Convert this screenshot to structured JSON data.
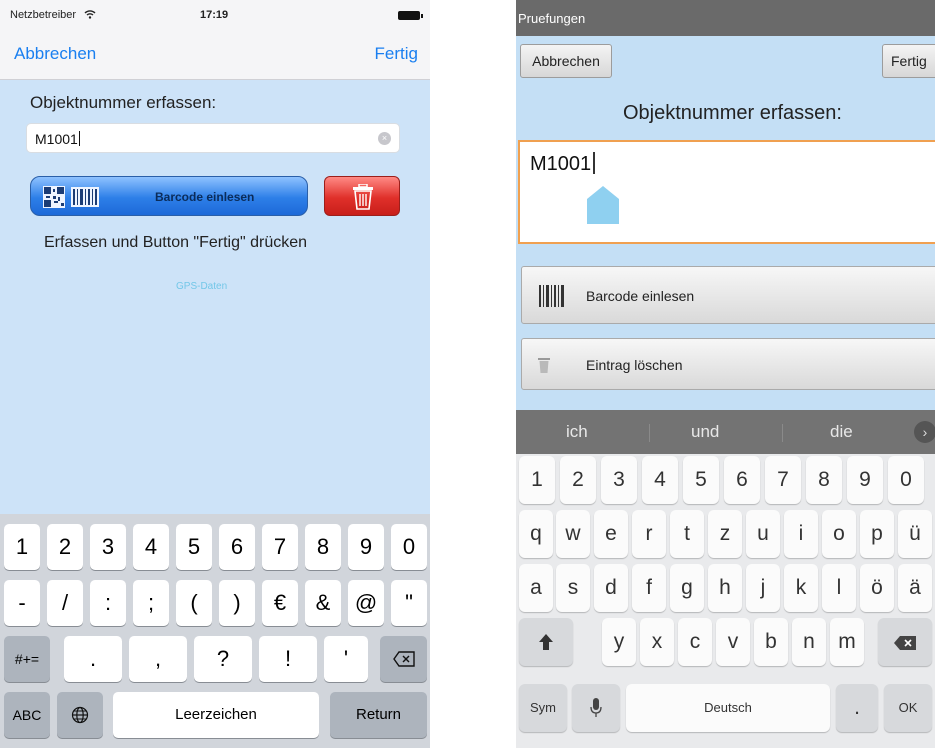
{
  "ios": {
    "status": {
      "carrier": "Netzbetreiber",
      "time": "17:19"
    },
    "nav": {
      "cancel": "Abbrechen",
      "done": "Fertig"
    },
    "field_label": "Objektnummer erfassen:",
    "field_value": "M1001",
    "barcode_label": "Barcode einlesen",
    "hint": "Erfassen und Button \"Fertig\" drücken",
    "gps": "GPS-Daten",
    "keys": {
      "row1": [
        "1",
        "2",
        "3",
        "4",
        "5",
        "6",
        "7",
        "8",
        "9",
        "0"
      ],
      "row2": [
        "-",
        "/",
        ":",
        ";",
        "(",
        ")",
        "€",
        "&",
        "@",
        "\""
      ],
      "row3_left": "#+=",
      "row3": [
        ".",
        ",",
        "?",
        "!",
        "'"
      ],
      "row4": {
        "abc": "ABC",
        "space": "Leerzeichen",
        "return": "Return"
      }
    }
  },
  "android": {
    "title": "Pruefungen",
    "cancel": "Abbrechen",
    "done": "Fertig",
    "field_label": "Objektnummer erfassen:",
    "field_value": "M1001",
    "barcode_label": "Barcode einlesen",
    "delete_label": "Eintrag löschen",
    "suggestions": [
      "ich",
      "und",
      "die"
    ],
    "keys": {
      "row1": [
        "1",
        "2",
        "3",
        "4",
        "5",
        "6",
        "7",
        "8",
        "9",
        "0"
      ],
      "row2": [
        "q",
        "w",
        "e",
        "r",
        "t",
        "z",
        "u",
        "i",
        "o",
        "p",
        "ü"
      ],
      "row3": [
        "a",
        "s",
        "d",
        "f",
        "g",
        "h",
        "j",
        "k",
        "l",
        "ö",
        "ä"
      ],
      "row4": [
        "y",
        "x",
        "c",
        "v",
        "b",
        "n",
        "m"
      ],
      "row5": {
        "sym": "Sym",
        "space": "Deutsch",
        "period": ".",
        "ok": "OK"
      }
    }
  }
}
